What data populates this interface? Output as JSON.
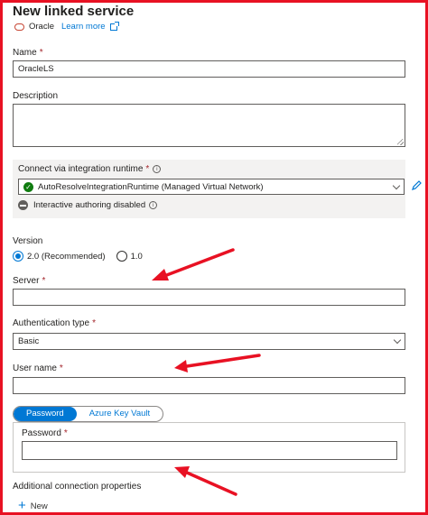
{
  "header": {
    "title": "New linked service",
    "service": "Oracle",
    "learn_more": "Learn more"
  },
  "fields": {
    "name": {
      "label": "Name",
      "value": "OracleLS"
    },
    "description": {
      "label": "Description",
      "value": ""
    },
    "runtime": {
      "label": "Connect via integration runtime",
      "value": "AutoResolveIntegrationRuntime (Managed Virtual Network)",
      "status": "Interactive authoring disabled"
    },
    "version": {
      "label": "Version",
      "options": [
        "2.0 (Recommended)",
        "1.0"
      ],
      "selected": "2.0 (Recommended)"
    },
    "server": {
      "label": "Server",
      "value": ""
    },
    "auth_type": {
      "label": "Authentication type",
      "value": "Basic"
    },
    "user_name": {
      "label": "User name",
      "value": ""
    },
    "password_tabs": [
      "Password",
      "Azure Key Vault"
    ],
    "password": {
      "label": "Password",
      "value": ""
    }
  },
  "additional": {
    "label": "Additional connection properties",
    "new_label": "New"
  },
  "required_mark": "*",
  "info_glyph": "i",
  "check_glyph": "✓",
  "plus_glyph": "+",
  "colors": {
    "frame": "#e81123",
    "accent": "#0078d4",
    "success": "#107c10",
    "oracle": "#c74634"
  },
  "icons": [
    "oracle-logo-icon",
    "external-link-icon",
    "check-circle-icon",
    "blocked-icon",
    "info-icon",
    "edit-pencil-icon",
    "chevron-down-icon",
    "plus-icon"
  ]
}
